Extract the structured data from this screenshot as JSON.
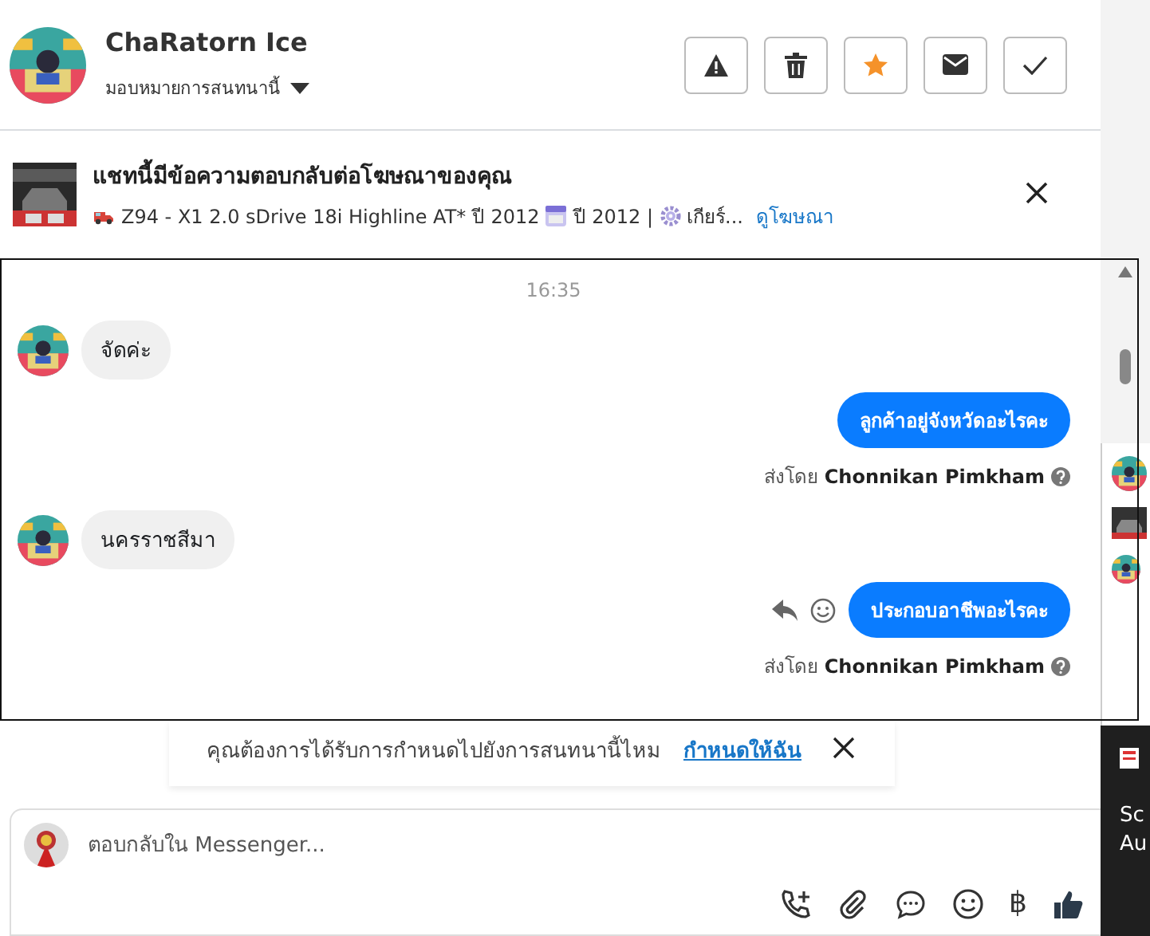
{
  "header": {
    "name": "ChaRatorn Ice",
    "assign_label": "มอบหมายการสนทนานี้",
    "actions": [
      {
        "kind": "alert",
        "on": false
      },
      {
        "kind": "trash",
        "on": false
      },
      {
        "kind": "star",
        "on": true
      },
      {
        "kind": "mail",
        "on": false
      },
      {
        "kind": "check",
        "on": false
      }
    ]
  },
  "ad": {
    "title": "แชทนี้มีข้อความตอบกลับต่อโฆษณาของคุณ",
    "details": [
      {
        "kind": "car",
        "text": "Z94 - X1 2.0 sDrive 18i Highline AT* ปี 2012"
      },
      {
        "kind": "calendar",
        "text": "ปี 2012 |"
      },
      {
        "kind": "gear",
        "text": "เกียร์..."
      }
    ],
    "link": "ดูโฆษณา"
  },
  "messages": [
    {
      "kind": "time",
      "text": "16:35"
    },
    {
      "kind": "incoming",
      "text": "จัดค่ะ"
    },
    {
      "kind": "outgoing",
      "text": "ลูกค้าอยู่จังหวัดอะไรคะ",
      "sent_by_label": "ส่งโดย",
      "sender": "Chonnikan Pimkham",
      "hovered": false
    },
    {
      "kind": "incoming",
      "text": "นครราชสีมา"
    },
    {
      "kind": "outgoing",
      "text": "ประกอบอาชีพอะไรคะ",
      "sent_by_label": "ส่งโดย",
      "sender": "Chonnikan Pimkham",
      "hovered": true
    }
  ],
  "notice": {
    "text": "คุณต้องการได้รับการกำหนดไปยังการสนทนานี้ไหม",
    "link": "กำหนดให้ฉัน"
  },
  "composer": {
    "placeholder": "ตอบกลับใน Messenger...",
    "tools": [
      {
        "kind": "call"
      },
      {
        "kind": "attach"
      },
      {
        "kind": "chat"
      },
      {
        "kind": "emoji"
      },
      {
        "kind": "payment",
        "text": "฿"
      },
      {
        "kind": "like"
      }
    ]
  },
  "side_popup": {
    "lines": [
      "Sc",
      "Au"
    ]
  }
}
